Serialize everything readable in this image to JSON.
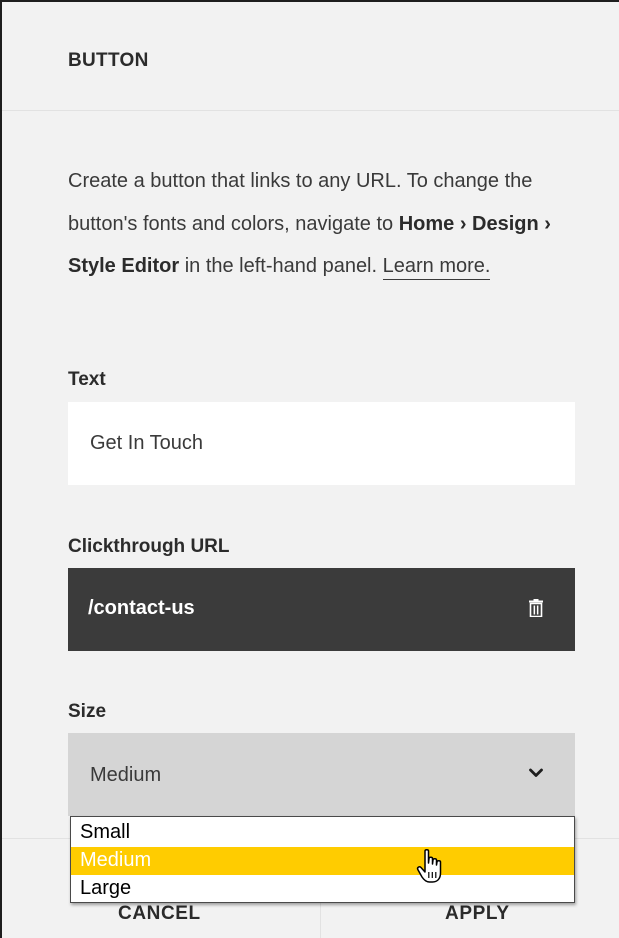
{
  "panel": {
    "title": "BUTTON"
  },
  "description": {
    "text_before": "Create a button that links to any URL. To change the button's fonts and colors, navigate to ",
    "path": "Home › Design › Style Editor",
    "text_after": " in the left-hand panel. ",
    "link": "Learn more."
  },
  "text_field": {
    "label": "Text",
    "value": "Get In Touch"
  },
  "url_field": {
    "label": "Clickthrough URL",
    "value": "/contact-us",
    "delete_icon": "trash-icon"
  },
  "size_field": {
    "label": "Size",
    "value": "Medium",
    "icon": "chevron-down-icon",
    "options": [
      "Small",
      "Medium",
      "Large"
    ],
    "highlighted_option": "Medium"
  },
  "footer": {
    "cancel_label": "CANCEL",
    "apply_label": "APPLY"
  },
  "colors": {
    "panel_background": "#f2f2f2",
    "url_field_background": "#3b3b3b",
    "select_background": "#d5d5d5",
    "highlight": "#ffcc00"
  }
}
